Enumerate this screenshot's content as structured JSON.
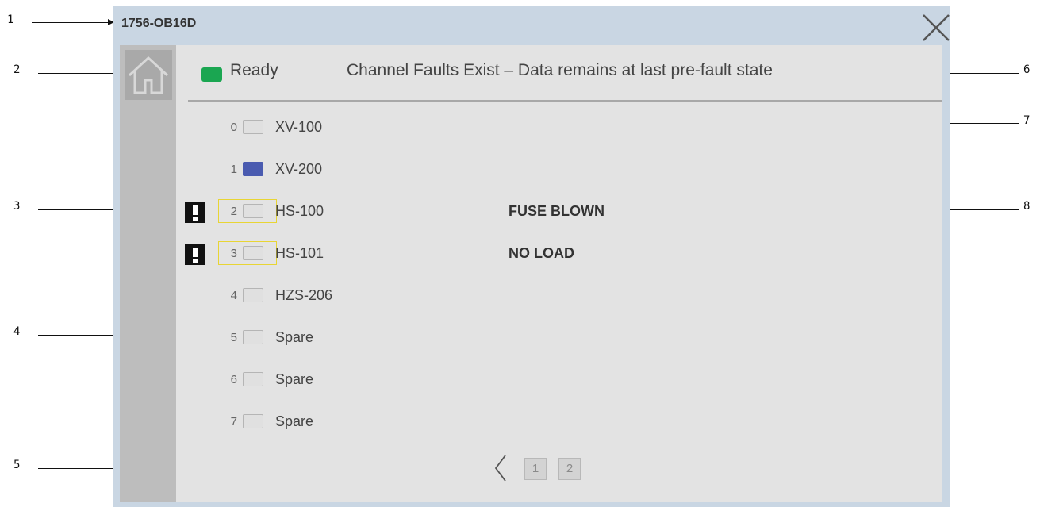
{
  "window": {
    "title": "1756-OB16D"
  },
  "status": {
    "label": "Ready",
    "color": "#1aa651"
  },
  "fault_message": "Channel Faults Exist – Data remains at last pre-fault state",
  "channels": [
    {
      "num": "0",
      "name": "XV-100",
      "on": false,
      "fault": ""
    },
    {
      "num": "1",
      "name": "XV-200",
      "on": true,
      "fault": ""
    },
    {
      "num": "2",
      "name": "HS-100",
      "on": false,
      "fault": "FUSE BLOWN"
    },
    {
      "num": "3",
      "name": "HS-101",
      "on": false,
      "fault": "NO LOAD"
    },
    {
      "num": "4",
      "name": "HZS-206",
      "on": false,
      "fault": ""
    },
    {
      "num": "5",
      "name": "Spare",
      "on": false,
      "fault": ""
    },
    {
      "num": "6",
      "name": "Spare",
      "on": false,
      "fault": ""
    },
    {
      "num": "7",
      "name": "Spare",
      "on": false,
      "fault": ""
    }
  ],
  "colors": {
    "channel_on": "#4a5bb0",
    "fault_frame": "#e8d534"
  },
  "pagination": {
    "pages": [
      "1",
      "2"
    ]
  },
  "callouts": [
    "1",
    "2",
    "3",
    "4",
    "5",
    "6",
    "7",
    "8"
  ],
  "icons": {
    "close": "close-icon",
    "home": "home-icon",
    "fault": "exclamation-icon",
    "prev": "chevron-left-icon"
  }
}
